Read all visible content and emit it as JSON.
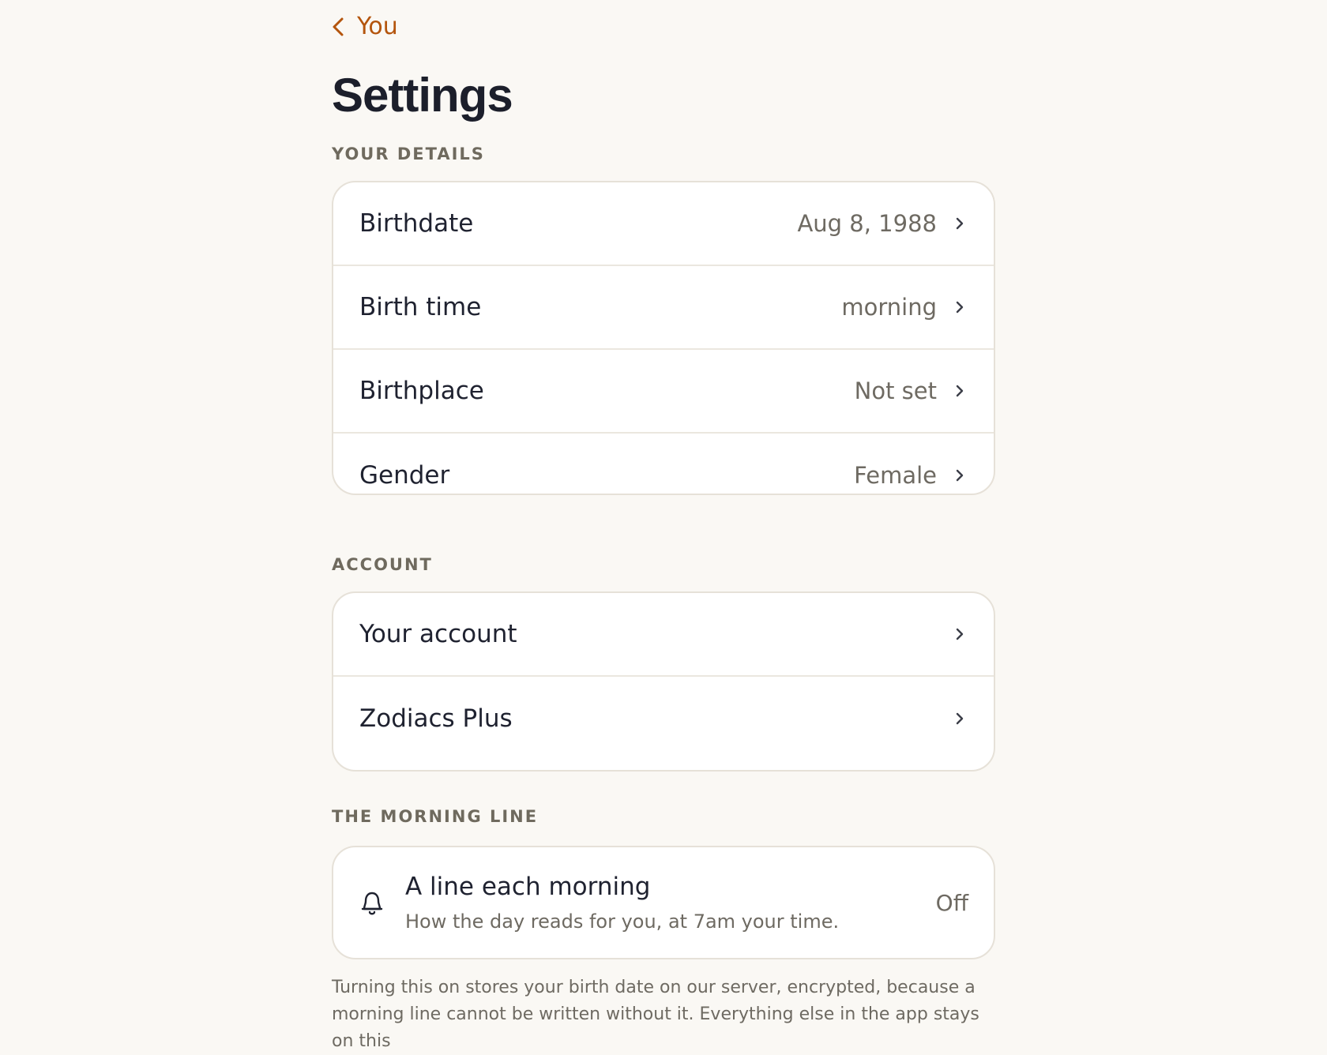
{
  "nav": {
    "back_label": "You"
  },
  "page": {
    "title": "Settings"
  },
  "details": {
    "label": "YOUR DETAILS",
    "rows": [
      {
        "label": "Birthdate",
        "value": "Aug 8, 1988"
      },
      {
        "label": "Birth time",
        "value": "morning"
      },
      {
        "label": "Birthplace",
        "value": "Not set"
      },
      {
        "label": "Gender",
        "value": "Female"
      }
    ]
  },
  "account": {
    "label": "ACCOUNT",
    "rows": [
      {
        "label": "Your account"
      },
      {
        "label": "Zodiacs Plus"
      }
    ]
  },
  "morning": {
    "label": "THE MORNING LINE",
    "title": "A line each morning",
    "subtitle": "How the day reads for you, at 7am your time.",
    "state": "Off",
    "footnote": "Turning this on stores your birth date on our server, encrypted, because a morning line cannot be written without it. Everything else in the app stays on this"
  },
  "colors": {
    "accent": "#b4550d",
    "background": "#faf8f4",
    "card": "#ffffff",
    "border": "#e6e1d8"
  },
  "icons": {
    "back": "chevron-left-icon",
    "row": "chevron-right-icon",
    "morning": "bell-icon"
  }
}
